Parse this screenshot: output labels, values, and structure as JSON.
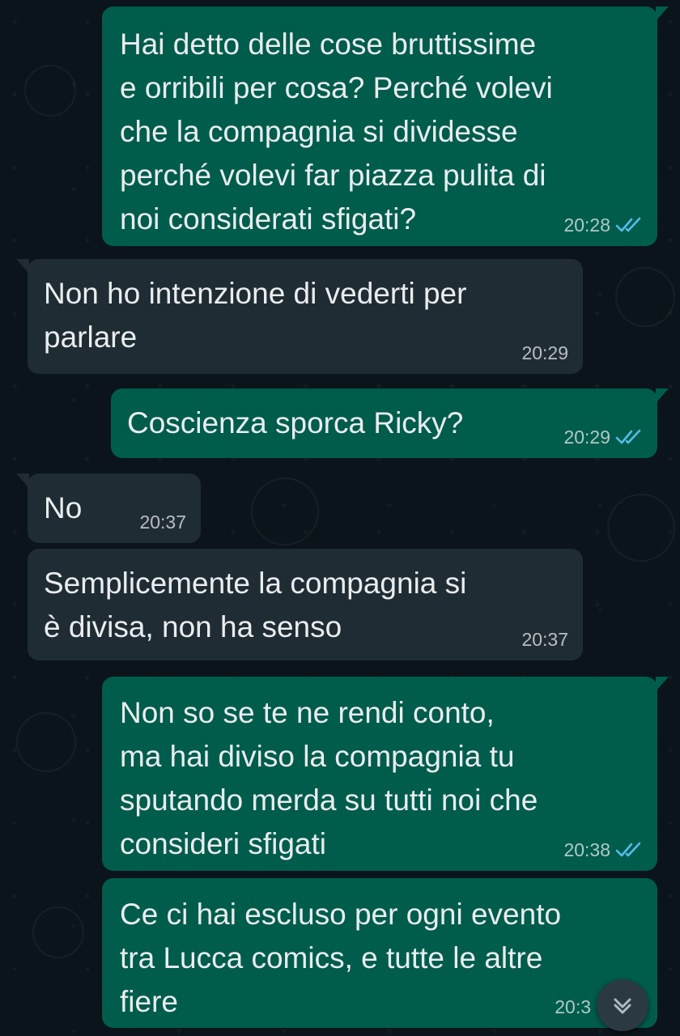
{
  "messages": [
    {
      "direction": "out",
      "text": "Hai detto delle cose bruttissime\ne orribili per cosa? Perché volevi\nche la compagnia si dividesse\nperché volevi far piazza pulita di\nnoi considerati sfigati?",
      "time": "20:28",
      "status": "read"
    },
    {
      "direction": "in",
      "text": "Non ho intenzione di vederti per\nparlare",
      "time": "20:29"
    },
    {
      "direction": "out",
      "text": "Coscienza sporca Ricky?",
      "time": "20:29",
      "status": "read"
    },
    {
      "direction": "in",
      "text": "No",
      "time": "20:37"
    },
    {
      "direction": "in",
      "text": "Semplicemente la compagnia si\nè divisa, non ha senso",
      "time": "20:37"
    },
    {
      "direction": "out",
      "text": "Non so se te ne rendi conto,\nma hai diviso la compagnia tu\nsputando merda su tutti noi che\nconsideri sfigati",
      "time": "20:38",
      "status": "read"
    },
    {
      "direction": "out",
      "text": "Ce ci hai escluso per ogni evento\ntra Lucca comics, e tutte le altre\nfiere",
      "time": "20:3",
      "status": "read"
    }
  ],
  "colors": {
    "background": "#0b141a",
    "outgoing_bubble": "#005c4b",
    "incoming_bubble": "#202c33",
    "read_ticks": "#53bdeb",
    "text": "#e9edef"
  },
  "icons": {
    "read_status": "double-check-icon",
    "scroll_down": "chevron-down-icon"
  }
}
